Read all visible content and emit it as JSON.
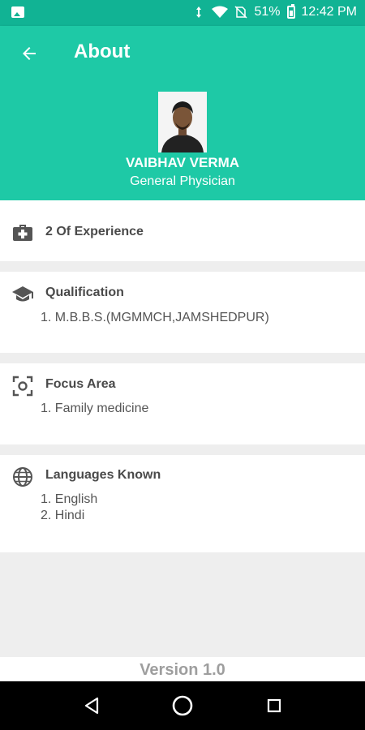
{
  "status_bar": {
    "battery": "51%",
    "time": "12:42 PM",
    "icons": [
      "image-icon",
      "data-arrows-icon",
      "wifi-icon",
      "no-sim-icon",
      "battery-icon"
    ]
  },
  "app_bar": {
    "title": "About",
    "back_icon": "arrow-left-icon"
  },
  "profile": {
    "name": "VAIBHAV VERMA",
    "specialty": "General Physician"
  },
  "experience": {
    "icon": "medical-bag-icon",
    "text": "2 Of Experience"
  },
  "qualification": {
    "icon": "graduation-cap-icon",
    "title": "Qualification",
    "items": [
      "1. M.B.B.S.(MGMMCH,JAMSHEDPUR)"
    ]
  },
  "focus_area": {
    "icon": "focus-camera-icon",
    "title": "Focus Area",
    "items": [
      "1. Family medicine"
    ]
  },
  "languages": {
    "icon": "globe-icon",
    "title": "Languages Known",
    "items": [
      "1. English",
      "2. Hindi"
    ]
  },
  "footer": {
    "version": "Version 1.0"
  },
  "nav_bar": {
    "buttons": [
      "back-triangle-icon",
      "home-circle-icon",
      "recents-square-icon"
    ]
  },
  "colors": {
    "primary": "#1ec9a6",
    "status_bar": "#11b394",
    "background": "#eeeeee"
  }
}
